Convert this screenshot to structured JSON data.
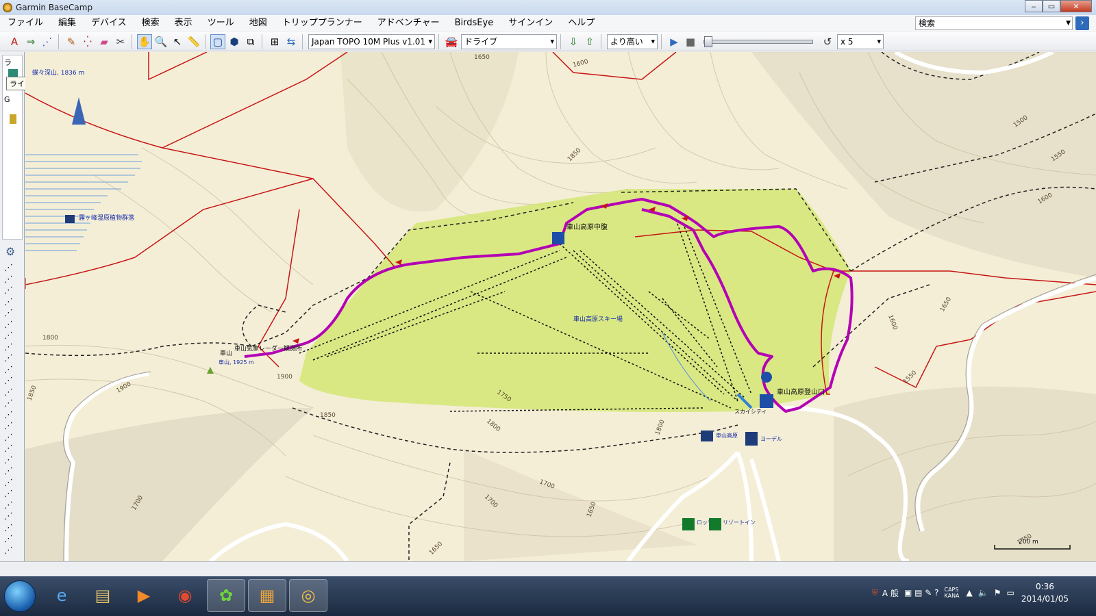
{
  "window": {
    "title": "Garmin BaseCamp"
  },
  "menu": [
    "ファイル",
    "編集",
    "デバイス",
    "検索",
    "表示",
    "ツール",
    "地図",
    "トリッププランナー",
    "アドベンチャー",
    "BirdsEye",
    "サインイン",
    "ヘルプ"
  ],
  "search": {
    "placeholder": "検索"
  },
  "toolbar": {
    "map_product": "Japan TOPO 10M Plus v1.01",
    "route_mode": "ドライブ",
    "detail_level": "より高い",
    "playback_speed": "x 5"
  },
  "left_panel": {
    "tree_label_1": "ラ",
    "tree_label_2": "G",
    "tooltip": "ライブラリ"
  },
  "map": {
    "labels": {
      "peak_top": "蝶々深山, 1836 m",
      "photo_spot": "霧ヶ峰湿原植物群落",
      "mid_station": "車山高原中腹",
      "ski_area": "車山高原スキー場",
      "trailhead": "車山高原登山口",
      "skycity": "スカイシティ",
      "kurumayama": "車山",
      "observatory": "車山気象レーダー観測所",
      "kurumayama_peak": "車山, 1925 m",
      "bus_stop": "車山高原",
      "restaurant": "ヨーデル",
      "lodge": "ロッヂ",
      "resort_inn": "リゾートイン",
      "scale": "200 m"
    },
    "contours": [
      "1650",
      "1600",
      "1850",
      "1500",
      "1550",
      "1600",
      "1900",
      "1900",
      "1850",
      "1850",
      "1750",
      "1800",
      "1700",
      "1650",
      "1650",
      "1700",
      "1800",
      "1700",
      "1550",
      "1600",
      "1750",
      "1800",
      "1650"
    ],
    "colors": {
      "track": "#b400b4",
      "trail": "#c81414",
      "ski_area": "#d2e66e",
      "terrain": "#f4eed7"
    }
  },
  "taskbar": {
    "tray_ime": "A 般",
    "caps": "CAPS",
    "kana": "KANA",
    "time": "0:36",
    "date": "2014/01/05"
  }
}
